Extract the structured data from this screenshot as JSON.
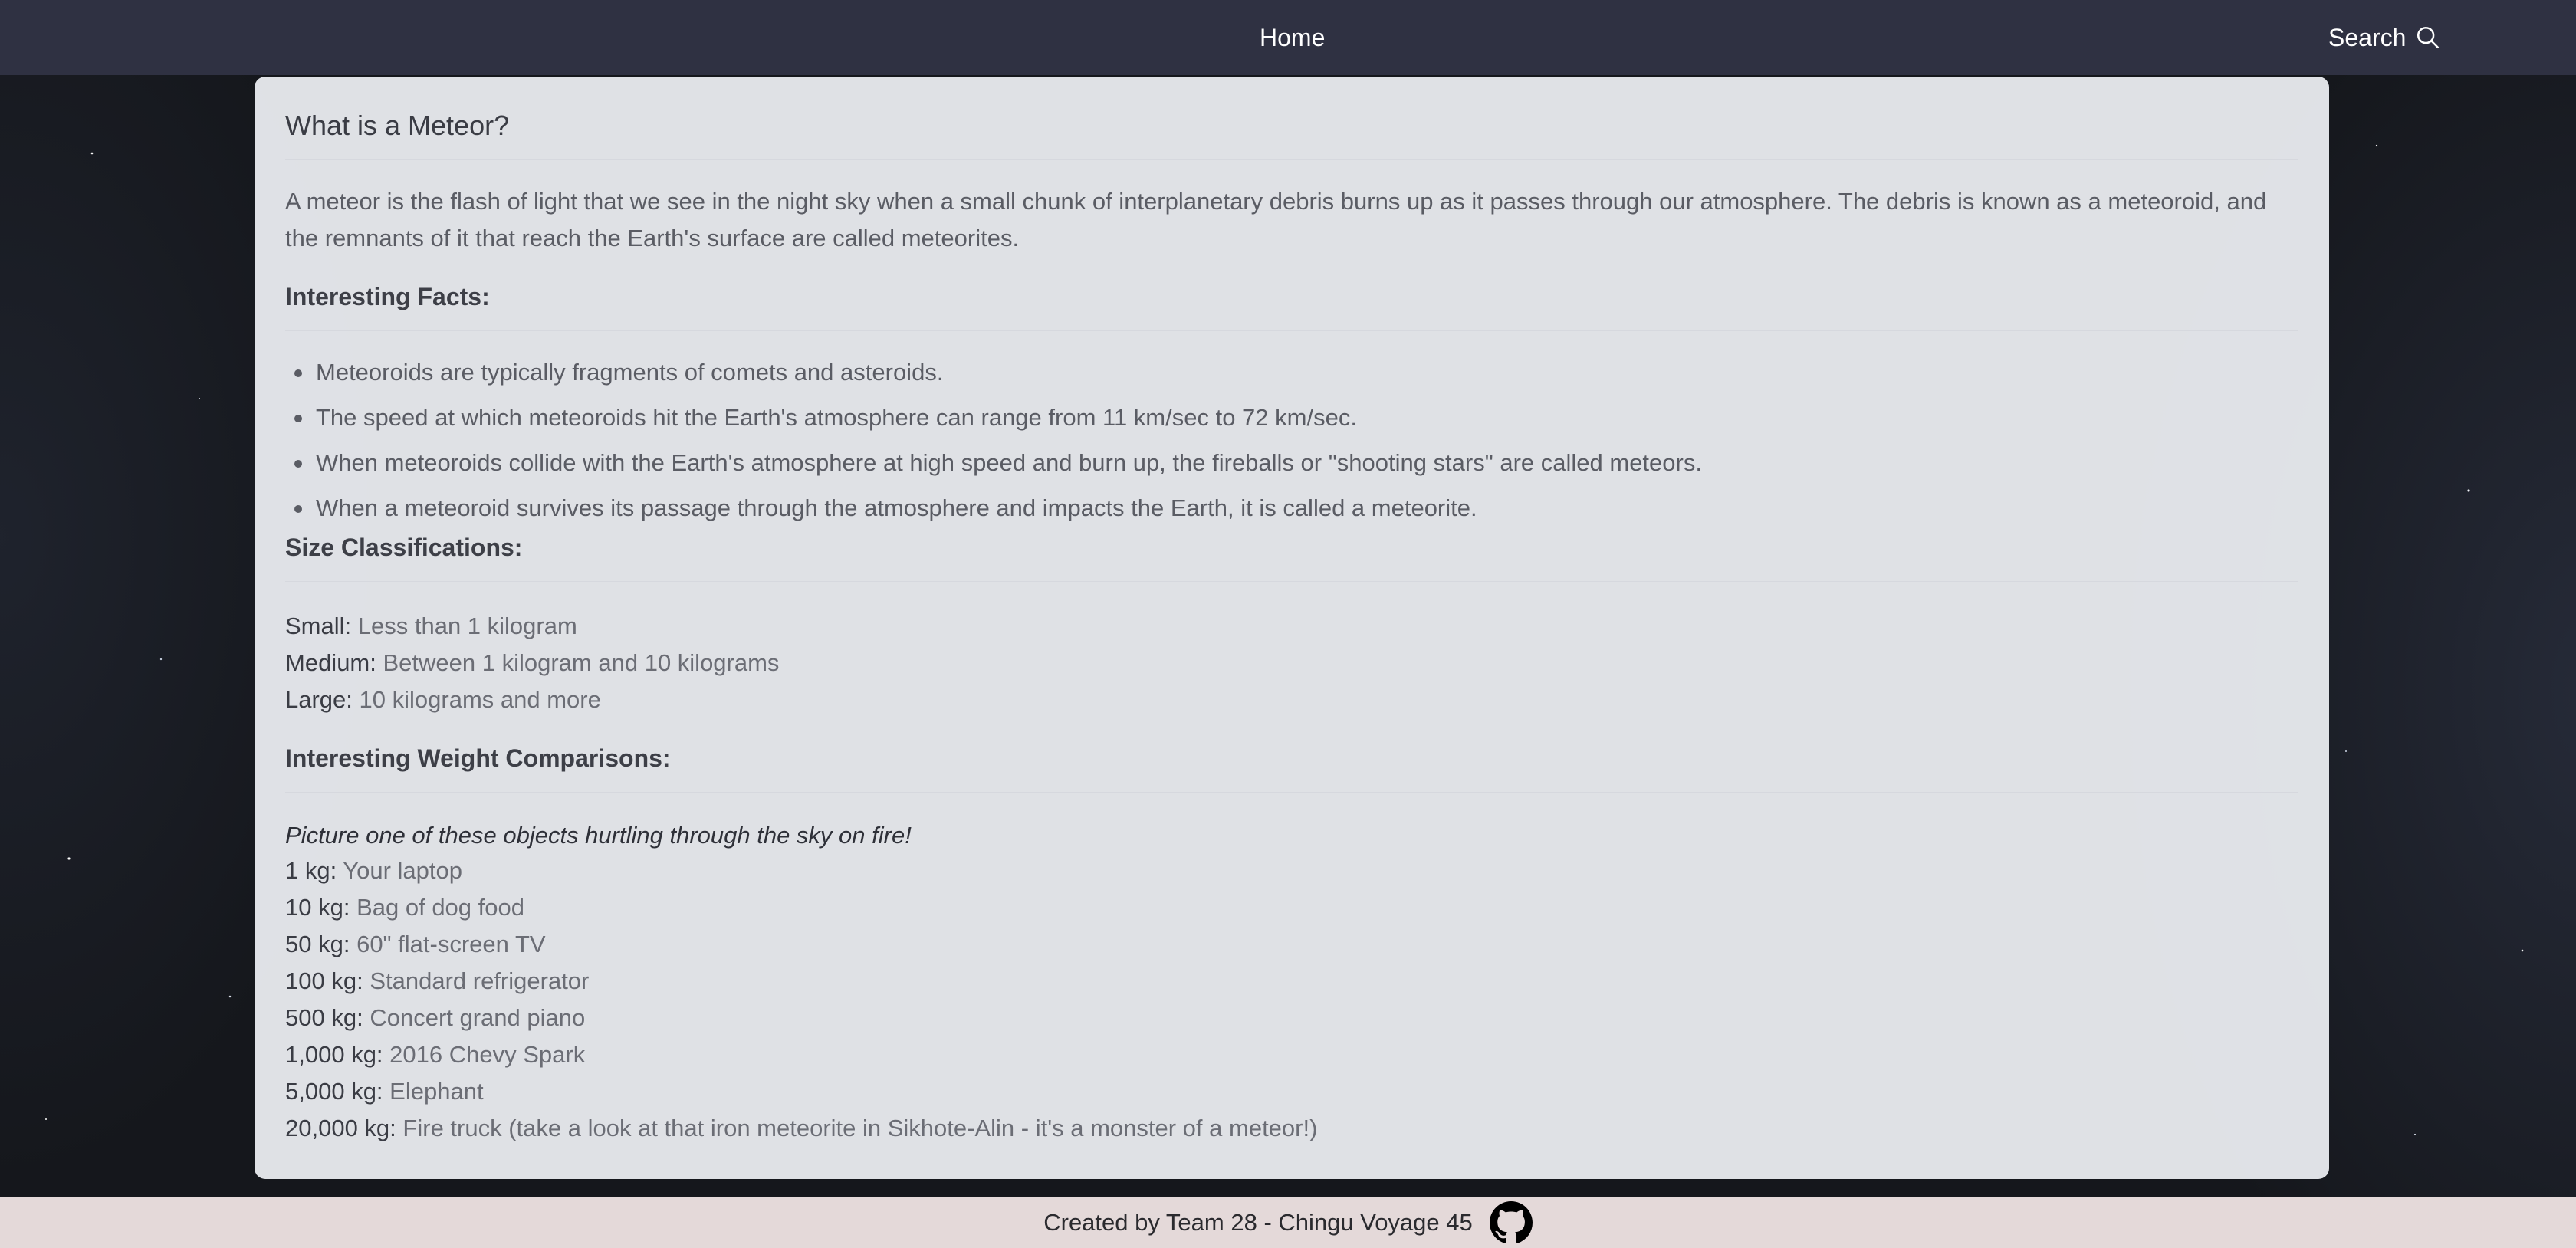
{
  "nav": {
    "home_label": "Home",
    "search_label": "Search",
    "search_icon": "search-icon"
  },
  "card": {
    "title": "What is a Meteor?",
    "intro": "A meteor is the flash of light that we see in the night sky when a small chunk of interplanetary debris burns up as it passes through our atmosphere. The debris is known as a meteoroid, and the remnants of it that reach the Earth's surface are called meteorites.",
    "facts_heading": "Interesting Facts:",
    "facts": [
      "Meteoroids are typically fragments of comets and asteroids.",
      "The speed at which meteoroids hit the Earth's atmosphere can range from 11 km/sec to 72 km/sec.",
      "When meteoroids collide with the Earth's atmosphere at high speed and burn up, the fireballs or \"shooting stars\" are called meteors.",
      "When a meteoroid survives its passage through the atmosphere and impacts the Earth, it is called a meteorite."
    ],
    "size_heading": "Size Classifications:",
    "sizes": [
      {
        "key": "Small:",
        "value": "Less than 1 kilogram"
      },
      {
        "key": "Medium:",
        "value": "Between 1 kilogram and 10 kilograms"
      },
      {
        "key": "Large:",
        "value": "10 kilograms and more"
      }
    ],
    "weight_heading": "Interesting Weight Comparisons:",
    "weight_tagline": "Picture one of these objects hurtling through the sky on fire!",
    "weights": [
      {
        "key": "1 kg:",
        "value": "Your laptop"
      },
      {
        "key": "10 kg:",
        "value": "Bag of dog food"
      },
      {
        "key": "50 kg:",
        "value": "60\" flat-screen TV"
      },
      {
        "key": "100 kg:",
        "value": "Standard refrigerator"
      },
      {
        "key": "500 kg:",
        "value": "Concert grand piano"
      },
      {
        "key": "1,000 kg:",
        "value": "2016 Chevy Spark"
      },
      {
        "key": "5,000 kg:",
        "value": "Elephant"
      },
      {
        "key": "20,000 kg:",
        "value": "Fire truck (take a look at that iron meteorite in Sikhote-Alin - it's a monster of a meteor!)"
      }
    ]
  },
  "footer": {
    "text": "Created by Team 28 - Chingu Voyage 45",
    "icon": "github-icon"
  },
  "colors": {
    "topbar": "#2f3142",
    "card": "#e6e8ec",
    "footer": "#e4d9d9"
  }
}
